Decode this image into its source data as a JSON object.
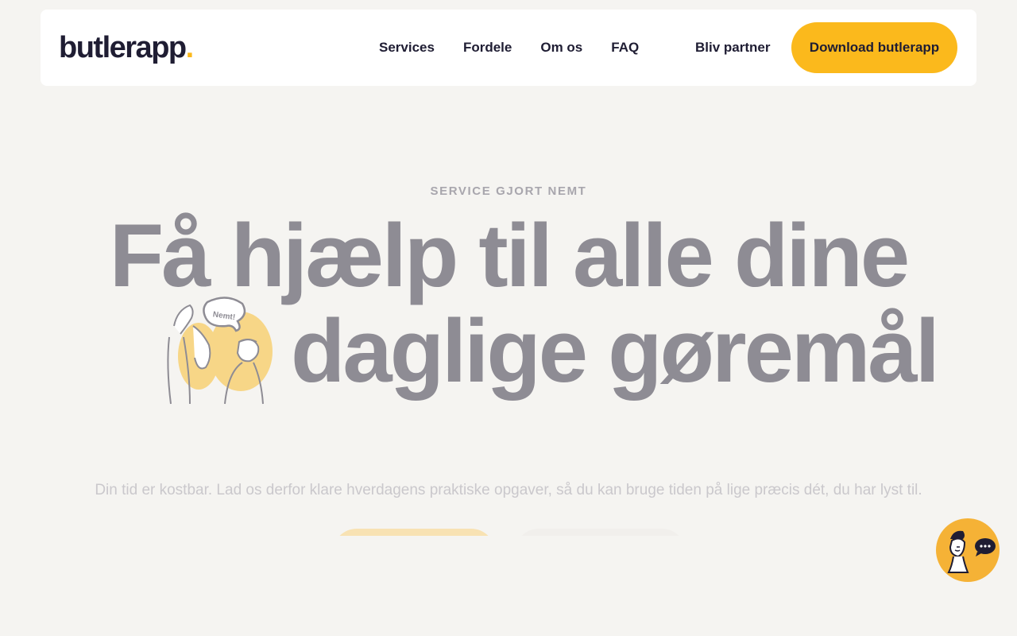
{
  "brand": {
    "name": "butlerapp",
    "dot": ".",
    "accent": "#fbb91c"
  },
  "nav": {
    "links": [
      {
        "label": "Services"
      },
      {
        "label": "Fordele"
      },
      {
        "label": "Om os"
      },
      {
        "label": "FAQ"
      }
    ],
    "partner_label": "Bliv partner",
    "download_label": "Download butlerapp"
  },
  "hero": {
    "eyebrow": "SERVICE GJORT NEMT",
    "headline_line1": "Få hjælp til alle dine",
    "headline_line2": "daglige gøremål",
    "illustration_bubble": "Nemt!",
    "subtext": "Din tid er kostbar. Lad os derfor klare hverdagens praktiske opgaver, så du kan bruge tiden på lige præcis dét, du har lyst til."
  },
  "chat": {
    "icon": "chat-bubble-icon"
  }
}
